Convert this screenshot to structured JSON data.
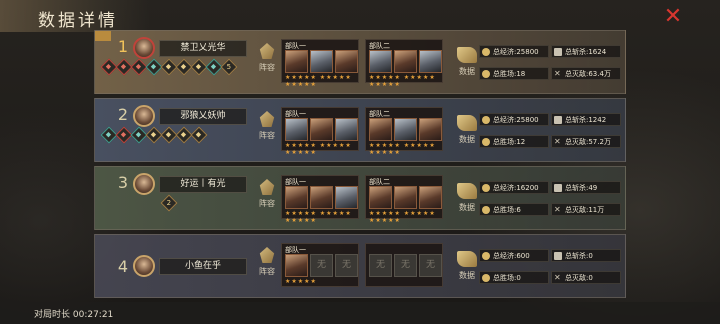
{
  "title": "数据详情",
  "close_label": "✕",
  "footer": {
    "label": "对局时长 00:27:21"
  },
  "lineup_label": "阵容",
  "data_label": "数据",
  "team1_label": "部队一",
  "team2_label": "部队二",
  "players": [
    {
      "rank": "1",
      "name": "禁卫乂光华",
      "badges": [
        "◆",
        "◆",
        "◆",
        "◆",
        "◆",
        "◆",
        "◆",
        "◆",
        "5"
      ],
      "stats": {
        "economy": "总经济:25800",
        "kills": "总斩杀:1624",
        "wins": "总胜场:18",
        "destroyed": "总灭敌:63.4万"
      }
    },
    {
      "rank": "2",
      "name": "邪狼乂妖帅",
      "badges": [
        "◆",
        "◆",
        "◆",
        "◆",
        "◆",
        "◆",
        "◆"
      ],
      "stats": {
        "economy": "总经济:25800",
        "kills": "总斩杀:1242",
        "wins": "总胜场:12",
        "destroyed": "总灭敌:57.2万"
      }
    },
    {
      "rank": "3",
      "name": "好运丨有光",
      "badges": [
        "2"
      ],
      "stats": {
        "economy": "总经济:16200",
        "kills": "总斩杀:49",
        "wins": "总胜场:6",
        "destroyed": "总灭敌:11万"
      }
    },
    {
      "rank": "4",
      "name": "小鱼在乎",
      "badges": [],
      "stats": {
        "economy": "总经济:600",
        "kills": "总斩杀:0",
        "wins": "总胜场:0",
        "destroyed": "总灭敌:0"
      }
    }
  ]
}
